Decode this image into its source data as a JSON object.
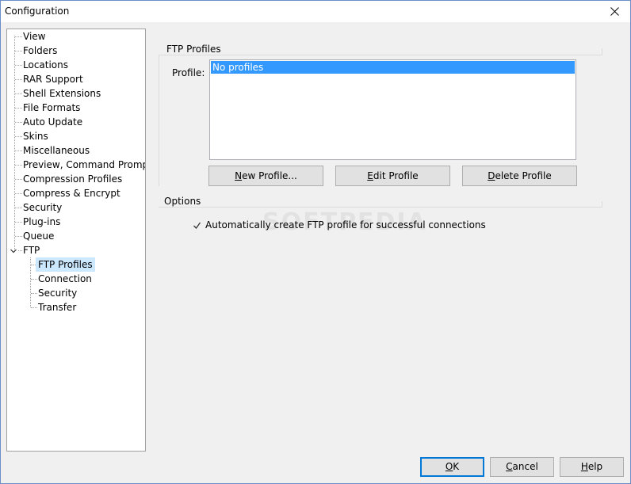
{
  "window": {
    "title": "Configuration"
  },
  "tree": {
    "items": [
      "View",
      "Folders",
      "Locations",
      "RAR Support",
      "Shell Extensions",
      "File Formats",
      "Auto Update",
      "Skins",
      "Miscellaneous",
      "Preview, Command Prompt",
      "Compression Profiles",
      "Compress & Encrypt",
      "Security",
      "Plug-ins",
      "Queue",
      "FTP"
    ],
    "ftp_children": [
      "FTP Profiles",
      "Connection",
      "Security",
      "Transfer"
    ],
    "selected": "FTP Profiles"
  },
  "ftp_profiles": {
    "group_label": "FTP Profiles",
    "profile_label": "Profile:",
    "list_items": [
      "No profiles"
    ],
    "new_button_first": "N",
    "new_button_rest": "ew Profile...",
    "edit_button_first": "E",
    "edit_button_rest": "dit Profile",
    "delete_button_first": "D",
    "delete_button_rest": "elete Profile"
  },
  "options": {
    "group_label": "Options",
    "auto_create_label": "Automatically create FTP profile for successful connections",
    "auto_create_checked": true
  },
  "footer": {
    "ok_first": "O",
    "ok_rest": "K",
    "cancel_first": "C",
    "cancel_rest": "ancel",
    "help_first": "H",
    "help_rest": "elp"
  },
  "watermark": "SOFTPEDIA"
}
